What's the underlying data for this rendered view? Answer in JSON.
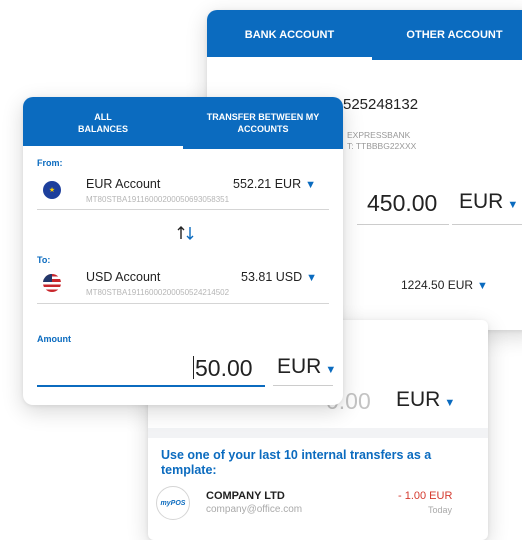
{
  "back_card": {
    "tabs": [
      {
        "label": "BANK ACCOUNT",
        "active": true
      },
      {
        "label": "OTHER ACCOUNT",
        "active": false
      }
    ],
    "iban_partial": "525248132",
    "bank_name_partial": "EXPRESSBANK",
    "swift_partial": "T: TTBBBG22XXX",
    "amount": "450.00",
    "currency": "EUR",
    "balance": "1224.50 EUR"
  },
  "lower_card": {
    "amount_placeholder": "0.00",
    "currency": "EUR",
    "template_title": "Use one of your last 10 internal transfers as a template:",
    "templates": [
      {
        "logo_text": "myPOS",
        "name": "COMPANY LTD",
        "email": "company@office.com",
        "amount": "- 1.00 EUR",
        "date": "Today"
      }
    ]
  },
  "front_card": {
    "tabs": [
      {
        "label_line1": "ALL",
        "label_line2": "BALANCES",
        "active": true
      },
      {
        "label_line1": "TRANSFER BETWEEN MY",
        "label_line2": "ACCOUNTS",
        "active": false
      }
    ],
    "from_label": "From:",
    "from_account": {
      "flag": "eu-flag",
      "name": "EUR Account",
      "balance": "552.21 EUR",
      "iban": "MT80STBA19116000200050693058351"
    },
    "to_label": "To:",
    "to_account": {
      "flag": "us-flag",
      "name": "USD Account",
      "balance": "53.81 USD",
      "iban": "MT80STBA19116000200050524214502"
    },
    "amount_label": "Amount",
    "amount_value": "50.00",
    "amount_currency": "EUR"
  },
  "colors": {
    "accent": "#0b6bbf",
    "negative": "#d43a2f"
  }
}
